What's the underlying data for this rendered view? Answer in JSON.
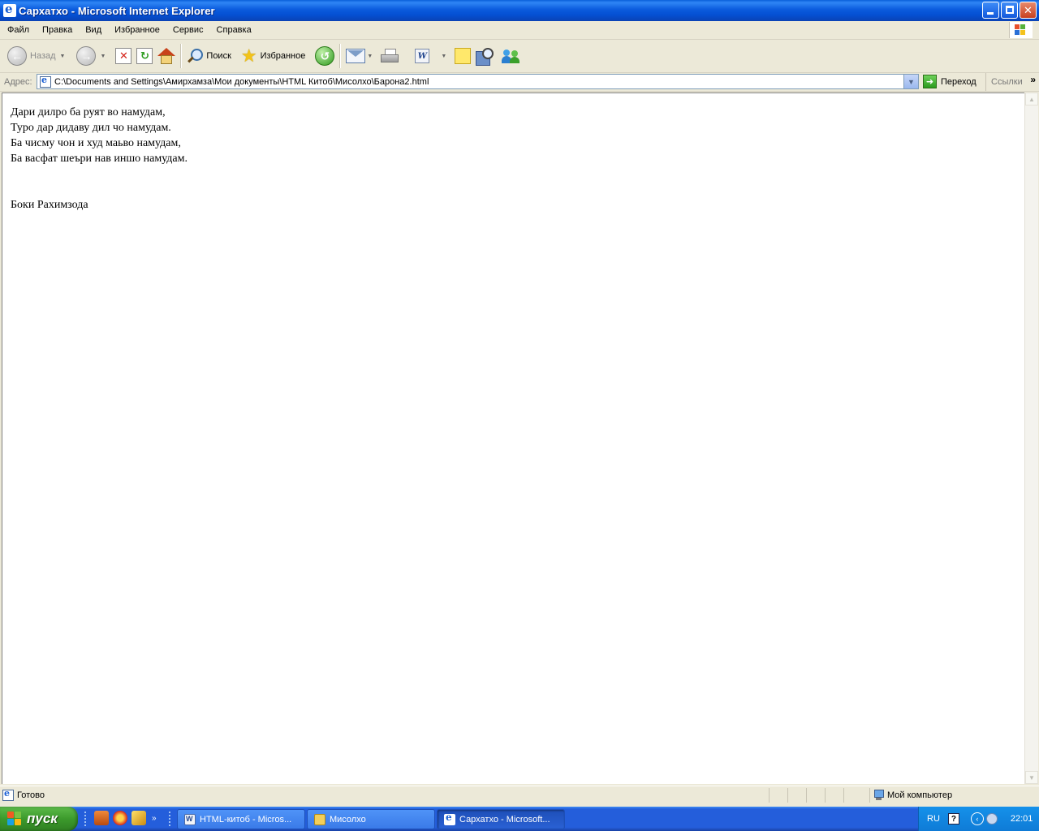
{
  "window": {
    "title": "Сархатхо - Microsoft Internet Explorer",
    "minimize_icon": "minimize-icon",
    "maximize_icon": "restore-icon",
    "close_icon": "close-icon"
  },
  "menu": {
    "items": [
      "Файл",
      "Правка",
      "Вид",
      "Избранное",
      "Сервис",
      "Справка"
    ]
  },
  "toolbar": {
    "back_label": "Назад",
    "search_label": "Поиск",
    "favorites_label": "Избранное"
  },
  "address": {
    "label": "Адрес:",
    "value": "C:\\Documents and Settings\\Амирхамза\\Мои документы\\HTML Китоб\\Мисолхо\\Барона2.html",
    "go_label": "Переход",
    "links_label": "Ссылки"
  },
  "content": {
    "lines": [
      "Дари дилро ба руят во намудам,",
      "Туро дар дидаву дил чо намудам.",
      "Ба чисму чон и худ маьво намудам,",
      "Ба васфат шеъри нав иншо намудам."
    ],
    "signature": "Боки Рахимзода"
  },
  "status": {
    "text": "Готово",
    "zone": "Мой компьютер"
  },
  "taskbar": {
    "start_label": "пуск",
    "tasks": [
      {
        "label": "HTML-китоб - Micros...",
        "icon": "word-icon"
      },
      {
        "label": "Мисолхо",
        "icon": "folder-icon"
      },
      {
        "label": "Сархатхо - Microsoft...",
        "icon": "ie-icon"
      }
    ],
    "lang": "RU",
    "clock": "22:01"
  },
  "colors": {
    "title_bar": "#0a5fd9",
    "taskbar": "#245edb",
    "start_button": "#3c9a2c",
    "chrome": "#ece9d8"
  }
}
